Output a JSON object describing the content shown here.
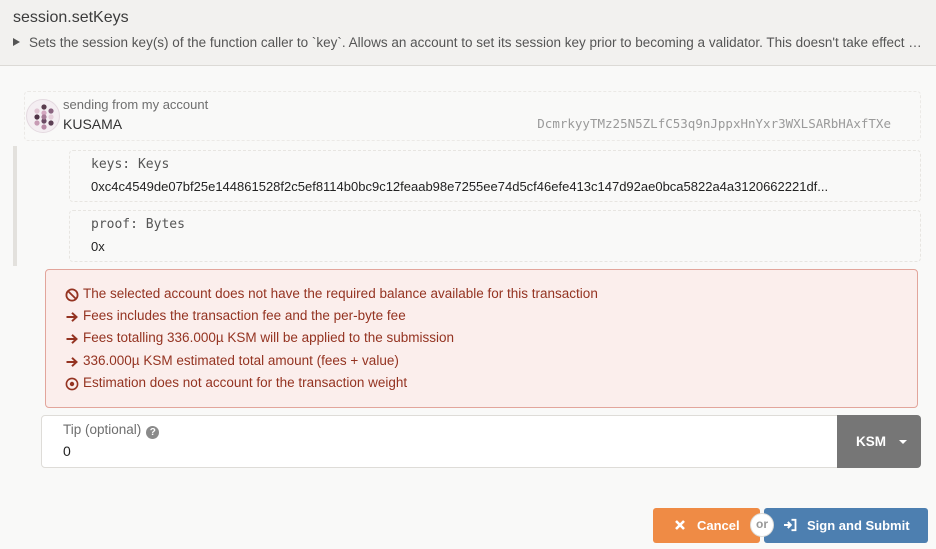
{
  "header": {
    "title": "session.setKeys",
    "description": "Sets the session key(s) of the function caller to `key`. Allows an account to set its session key prior to becoming a validator. This doesn't take effect until the next session."
  },
  "account": {
    "label": "sending from my account",
    "name": "KUSAMA",
    "address": "DcmrkyyTMz25N5ZLfC53q9nJppxHnYxr3WXLSARbHAxfTXe"
  },
  "params": [
    {
      "label": "keys: Keys",
      "value": "0xc4c4549de07bf25e144861528f2c5ef8114b0bc9c12feaab98e7255ee74d5cf46efe413c147d92ae0bca5822a4a3120662221df..."
    },
    {
      "label": "proof: Bytes",
      "value": "0x"
    }
  ],
  "errors": [
    {
      "icon": "ban-icon",
      "text": "The selected account does not have the required balance available for this transaction"
    },
    {
      "icon": "arrow-right-icon",
      "text": "Fees includes the transaction fee and the per-byte fee"
    },
    {
      "icon": "arrow-right-icon",
      "text": "Fees totalling 336.000µ KSM will be applied to the submission"
    },
    {
      "icon": "arrow-right-icon",
      "text": "336.000µ KSM estimated total amount (fees + value)"
    },
    {
      "icon": "dot-circle-icon",
      "text": "Estimation does not account for the transaction weight"
    }
  ],
  "tip": {
    "label": "Tip (optional)",
    "value": "0",
    "unit": "KSM"
  },
  "actions": {
    "cancel_label": "Cancel",
    "or_label": "or",
    "submit_label": "Sign and Submit"
  },
  "colors": {
    "error_text": "#943321",
    "error_bg": "#fbeeec",
    "cancel_button": "#ef8b45",
    "submit_button": "#4d7fb0"
  }
}
